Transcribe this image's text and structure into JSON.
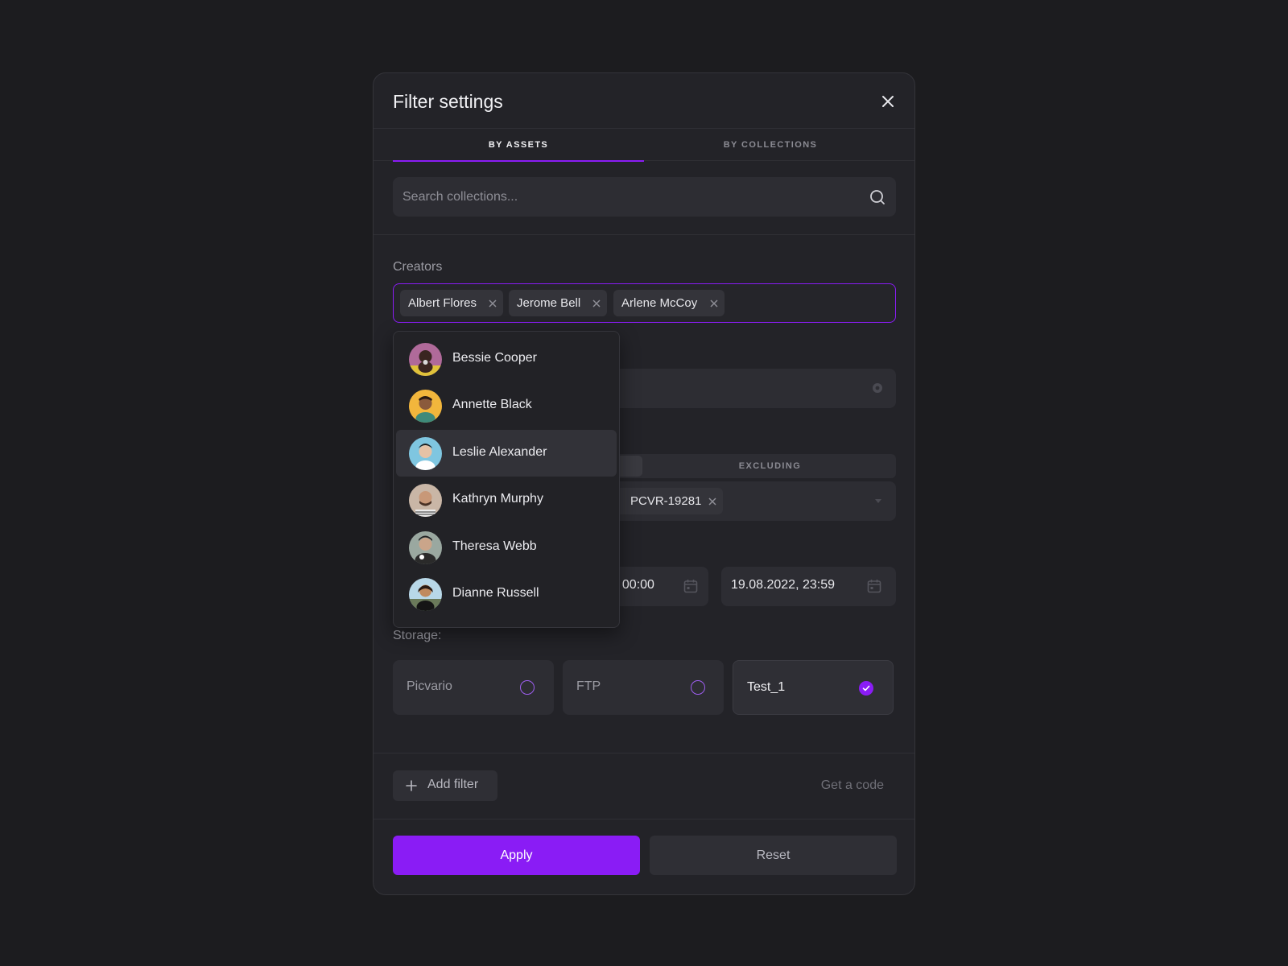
{
  "modal": {
    "title": "Filter settings",
    "tabs": [
      {
        "label": "BY ASSETS",
        "active": true
      },
      {
        "label": "BY COLLECTIONS",
        "active": false
      }
    ]
  },
  "search": {
    "placeholder": "Search collections..."
  },
  "creators": {
    "label": "Creators",
    "selected": [
      "Albert Flores",
      "Jerome Bell",
      "Arlene McCoy"
    ]
  },
  "dropdown": {
    "items": [
      {
        "name": "Bessie Cooper"
      },
      {
        "name": "Annette Black"
      },
      {
        "name": "Leslie Alexander",
        "highlighted": true
      },
      {
        "name": "Kathryn Murphy"
      },
      {
        "name": "Theresa Webb"
      },
      {
        "name": "Dianne Russell"
      }
    ]
  },
  "segment": {
    "excluding_label": "EXCLUDING"
  },
  "tag_chip": {
    "partial_label": "PCVR-19281"
  },
  "dates": {
    "from_partial": ", 00:00",
    "to": "19.08.2022, 23:59"
  },
  "storage": {
    "label": "Storage:",
    "options": [
      {
        "name": "Picvario",
        "checked": false
      },
      {
        "name": "FTP",
        "checked": false
      },
      {
        "name": "Test_1",
        "checked": true
      }
    ]
  },
  "footer": {
    "add_filter": "Add filter",
    "get_code": "Get a code"
  },
  "actions": {
    "apply": "Apply",
    "reset": "Reset"
  },
  "colors": {
    "accent": "#8a1cf5",
    "background": "#1c1c1f",
    "panel": "#232328"
  }
}
